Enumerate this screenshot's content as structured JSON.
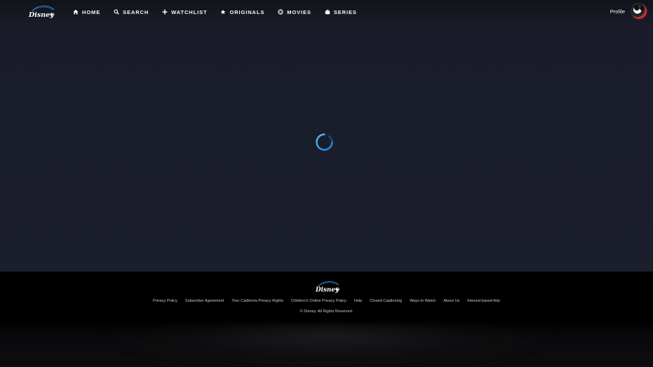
{
  "brand": {
    "logo_text": "Disney+"
  },
  "nav": {
    "items": [
      {
        "label": "HOME",
        "icon": "home-icon"
      },
      {
        "label": "SEARCH",
        "icon": "search-icon"
      },
      {
        "label": "WATCHLIST",
        "icon": "plus-icon"
      },
      {
        "label": "ORIGINALS",
        "icon": "star-icon"
      },
      {
        "label": "MOVIES",
        "icon": "movies-icon"
      },
      {
        "label": "SERIES",
        "icon": "tv-icon"
      }
    ]
  },
  "profile": {
    "label": "Profile"
  },
  "main": {
    "state": "loading"
  },
  "footer": {
    "logo_text": "Disney+",
    "links": [
      "Privacy Policy",
      "Subscriber Agreement",
      "Your California Privacy Rights",
      "Children's Online Privacy Policy",
      "Help",
      "Closed Captioning",
      "Ways to Watch",
      "About Us",
      "Interest-based Ads"
    ],
    "copyright": "© Disney. All Rights Reserved."
  },
  "colors": {
    "background": "#1a1d29",
    "footer_background": "#000000",
    "spinner_accent": "#1f80e0",
    "text": "#f9f9f9"
  }
}
